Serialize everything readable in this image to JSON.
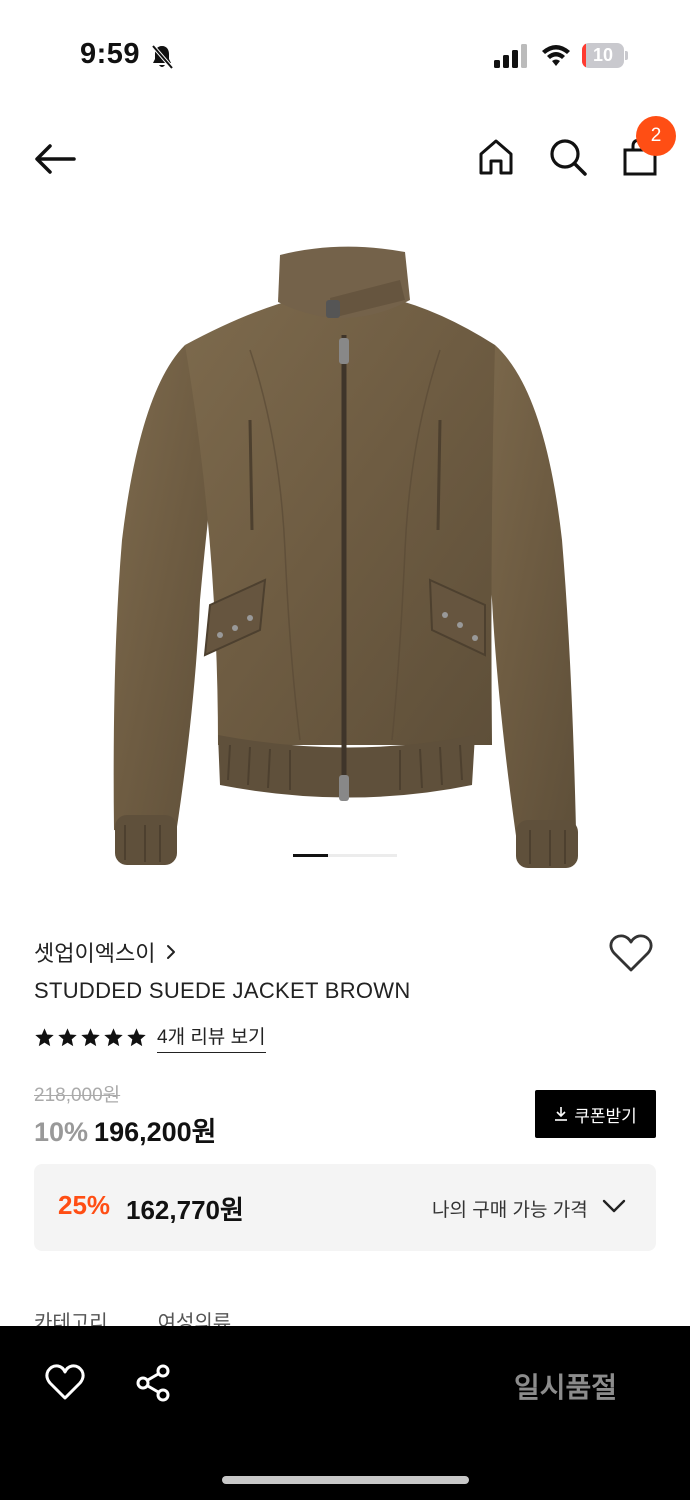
{
  "status_bar": {
    "time": "9:59",
    "battery_level": "10",
    "battery_fraction": 0.1,
    "icons": [
      "bell-slash-icon",
      "signal-icon",
      "wifi-icon",
      "battery-icon"
    ]
  },
  "nav": {
    "icons": [
      "back-arrow-icon",
      "home-icon",
      "search-icon",
      "shopping-bag-icon"
    ],
    "cart_count": "2",
    "badge_color": "#ff4e14"
  },
  "gallery": {
    "image_description_icon": "jacket-image",
    "current_page": 1,
    "page_indicator_fraction": 0.33
  },
  "product": {
    "brand": "셋업이엑스이",
    "name": "STUDDED SUEDE JACKET BROWN",
    "rating_stars": 5,
    "review_link": "4개 리뷰 보기",
    "original_price": "218,000원",
    "discount_rate": "10%",
    "sale_price": "196,200원",
    "coupon_button": "쿠폰받기"
  },
  "benefit": {
    "rate": "25%",
    "price": "162,770원",
    "label": "나의 구매 가능 가격",
    "accent_color": "#ff4e14"
  },
  "details": {
    "category_label": "카테고리",
    "category_value": "여성의류"
  },
  "bottom_bar": {
    "icons": [
      "heart-icon",
      "share-icon"
    ],
    "action_label": "일시품절"
  }
}
